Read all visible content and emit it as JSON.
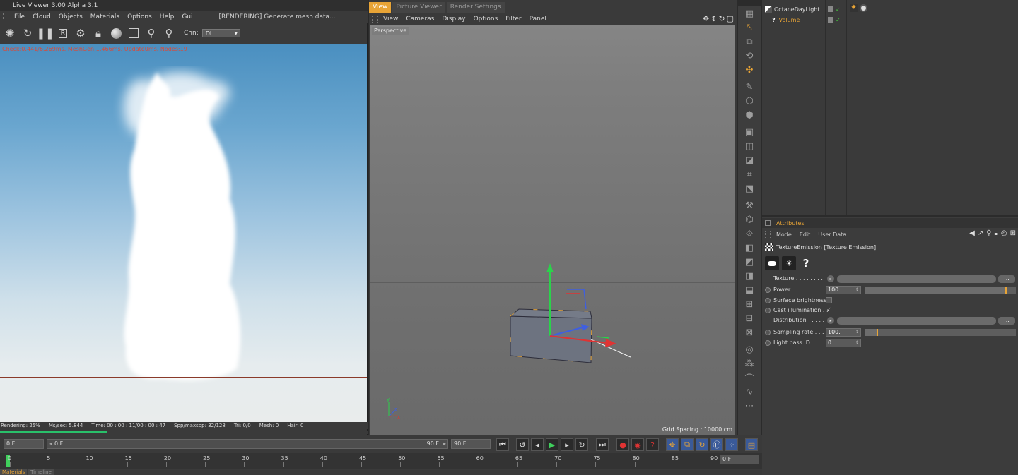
{
  "live_viewer": {
    "title": "Live Viewer 3.00 Alpha 3.1",
    "menu": [
      "File",
      "Cloud",
      "Objects",
      "Materials",
      "Options",
      "Help",
      "Gui"
    ],
    "status": "[RENDERING] Generate mesh data...",
    "channel_label": "Chn:",
    "channel_value": "DL",
    "render_info": "Check:0.441/6.269ms. MeshGen:1.466ms. Update0ms. Nodes:19",
    "stats": [
      "Rendering: 25%",
      "Ms/sec: 5.844",
      "Time: 00 : 00 : 11/00 : 00 : 47",
      "Spp/maxspp: 32/128",
      "Tri: 0/0",
      "Mesh: 0",
      "Hair: 0"
    ],
    "progress": 0.29,
    "progress_color": "#29c06a"
  },
  "viewport": {
    "tabs": [
      "View",
      "Picture Viewer",
      "Render Settings"
    ],
    "menu": [
      "View",
      "Cameras",
      "Display",
      "Options",
      "Filter",
      "Panel"
    ],
    "camera_label": "Perspective",
    "grid_spacing": "Grid Spacing : 10000 cm"
  },
  "object_manager": {
    "objects": [
      {
        "name": "OctaneDayLight"
      },
      {
        "name": "Volume"
      }
    ]
  },
  "attributes": {
    "title": "Attributes",
    "menu": [
      "Mode",
      "Edit",
      "User Data"
    ],
    "object_label": "TextureEmission [Texture Emission]",
    "params": {
      "texture": "Texture . . . . . . . .",
      "power": "Power . . . . . . . . .",
      "power_value": "100.",
      "power_fraction": 0.94,
      "surface_brightness": "Surface brightness",
      "cast_illumination": "Cast illumination . .",
      "distribution": "Distribution . . . . .",
      "sampling_rate": "Sampling rate . . . .",
      "sampling_value": "100.",
      "sampling_fraction": 0.09,
      "light_pass_id": "Light pass ID . . . .",
      "light_pass_value": "0",
      "dots": "..."
    }
  },
  "timeline": {
    "start_frame": "0 F",
    "range_start": "0 F",
    "range_end": "90 F",
    "end_frame": "90 F",
    "current_frame": "0 F",
    "ticks": [
      "0",
      "5",
      "10",
      "15",
      "20",
      "25",
      "30",
      "35",
      "40",
      "45",
      "50",
      "55",
      "60",
      "65",
      "70",
      "75",
      "80",
      "85",
      "90"
    ],
    "tabs": [
      "Materials",
      "Timeline"
    ]
  },
  "colors": {
    "accent": "#e8a436"
  }
}
